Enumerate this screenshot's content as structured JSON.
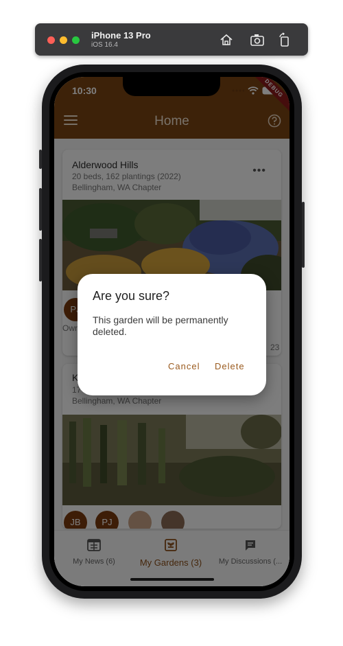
{
  "simulator": {
    "device": "iPhone 13 Pro",
    "os": "iOS 16.4"
  },
  "status_bar": {
    "time": "10:30",
    "debug_label": "DEBUG"
  },
  "app_bar": {
    "title": "Home"
  },
  "gardens": [
    {
      "name": "Alderwood Hills",
      "summary": "20 beds, 162 plantings (2022)",
      "chapter": "Bellingham, WA Chapter",
      "owner_initials": "PJ",
      "owner_label": "Own",
      "year_suffix": "23"
    },
    {
      "name": "K",
      "summary": "17",
      "chapter": "Bellingham, WA Chapter",
      "avatars": [
        "JB",
        "PJ"
      ]
    }
  ],
  "bottom_nav": {
    "items": [
      {
        "label": "My News (6)",
        "icon": "newspaper-icon"
      },
      {
        "label": "My Gardens (3)",
        "icon": "garden-icon"
      },
      {
        "label": "My Discussions (...",
        "icon": "chat-icon"
      }
    ]
  },
  "dialog": {
    "title": "Are you sure?",
    "body": "This garden will be permanently deleted.",
    "cancel": "Cancel",
    "delete": "Delete"
  },
  "colors": {
    "brand": "#7a4513",
    "accent": "#9a5a1e"
  }
}
